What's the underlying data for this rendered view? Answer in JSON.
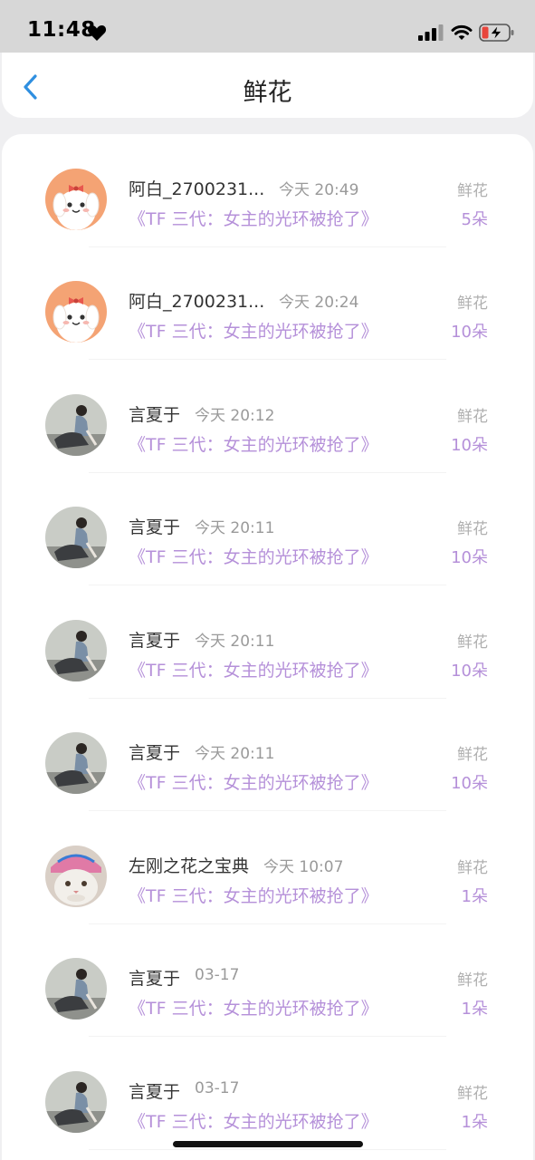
{
  "status_bar": {
    "time": "11:48",
    "icons": [
      "heart-icon",
      "cellular-signal-icon",
      "wifi-icon",
      "battery-charging-icon"
    ]
  },
  "nav": {
    "back_icon": "chevron-left-icon",
    "title": "鲜花"
  },
  "colors": {
    "accent_purple": "#b590d9",
    "back_blue": "#2f8fe0",
    "battery_red": "#e8453c"
  },
  "items": [
    {
      "avatar": "dog",
      "name": "阿白_2700231...",
      "time": "今天 20:49",
      "book": "《TF 三代：女主的光环被抢了》",
      "gift_label": "鲜花",
      "amount": "5朵"
    },
    {
      "avatar": "dog",
      "name": "阿白_2700231...",
      "time": "今天 20:24",
      "book": "《TF 三代：女主的光环被抢了》",
      "gift_label": "鲜花",
      "amount": "10朵"
    },
    {
      "avatar": "girl",
      "name": "言夏于",
      "time": "今天 20:12",
      "book": "《TF 三代：女主的光环被抢了》",
      "gift_label": "鲜花",
      "amount": "10朵"
    },
    {
      "avatar": "girl",
      "name": "言夏于",
      "time": "今天 20:11",
      "book": "《TF 三代：女主的光环被抢了》",
      "gift_label": "鲜花",
      "amount": "10朵"
    },
    {
      "avatar": "girl",
      "name": "言夏于",
      "time": "今天 20:11",
      "book": "《TF 三代：女主的光环被抢了》",
      "gift_label": "鲜花",
      "amount": "10朵"
    },
    {
      "avatar": "girl",
      "name": "言夏于",
      "time": "今天 20:11",
      "book": "《TF 三代：女主的光环被抢了》",
      "gift_label": "鲜花",
      "amount": "10朵"
    },
    {
      "avatar": "cat",
      "name": "左刚之花之宝典",
      "time": "今天 10:07",
      "book": "《TF 三代：女主的光环被抢了》",
      "gift_label": "鲜花",
      "amount": "1朵"
    },
    {
      "avatar": "girl",
      "name": "言夏于",
      "time": "03-17",
      "book": "《TF 三代：女主的光环被抢了》",
      "gift_label": "鲜花",
      "amount": "1朵"
    },
    {
      "avatar": "girl",
      "name": "言夏于",
      "time": "03-17",
      "book": "《TF 三代：女主的光环被抢了》",
      "gift_label": "鲜花",
      "amount": "1朵"
    }
  ]
}
